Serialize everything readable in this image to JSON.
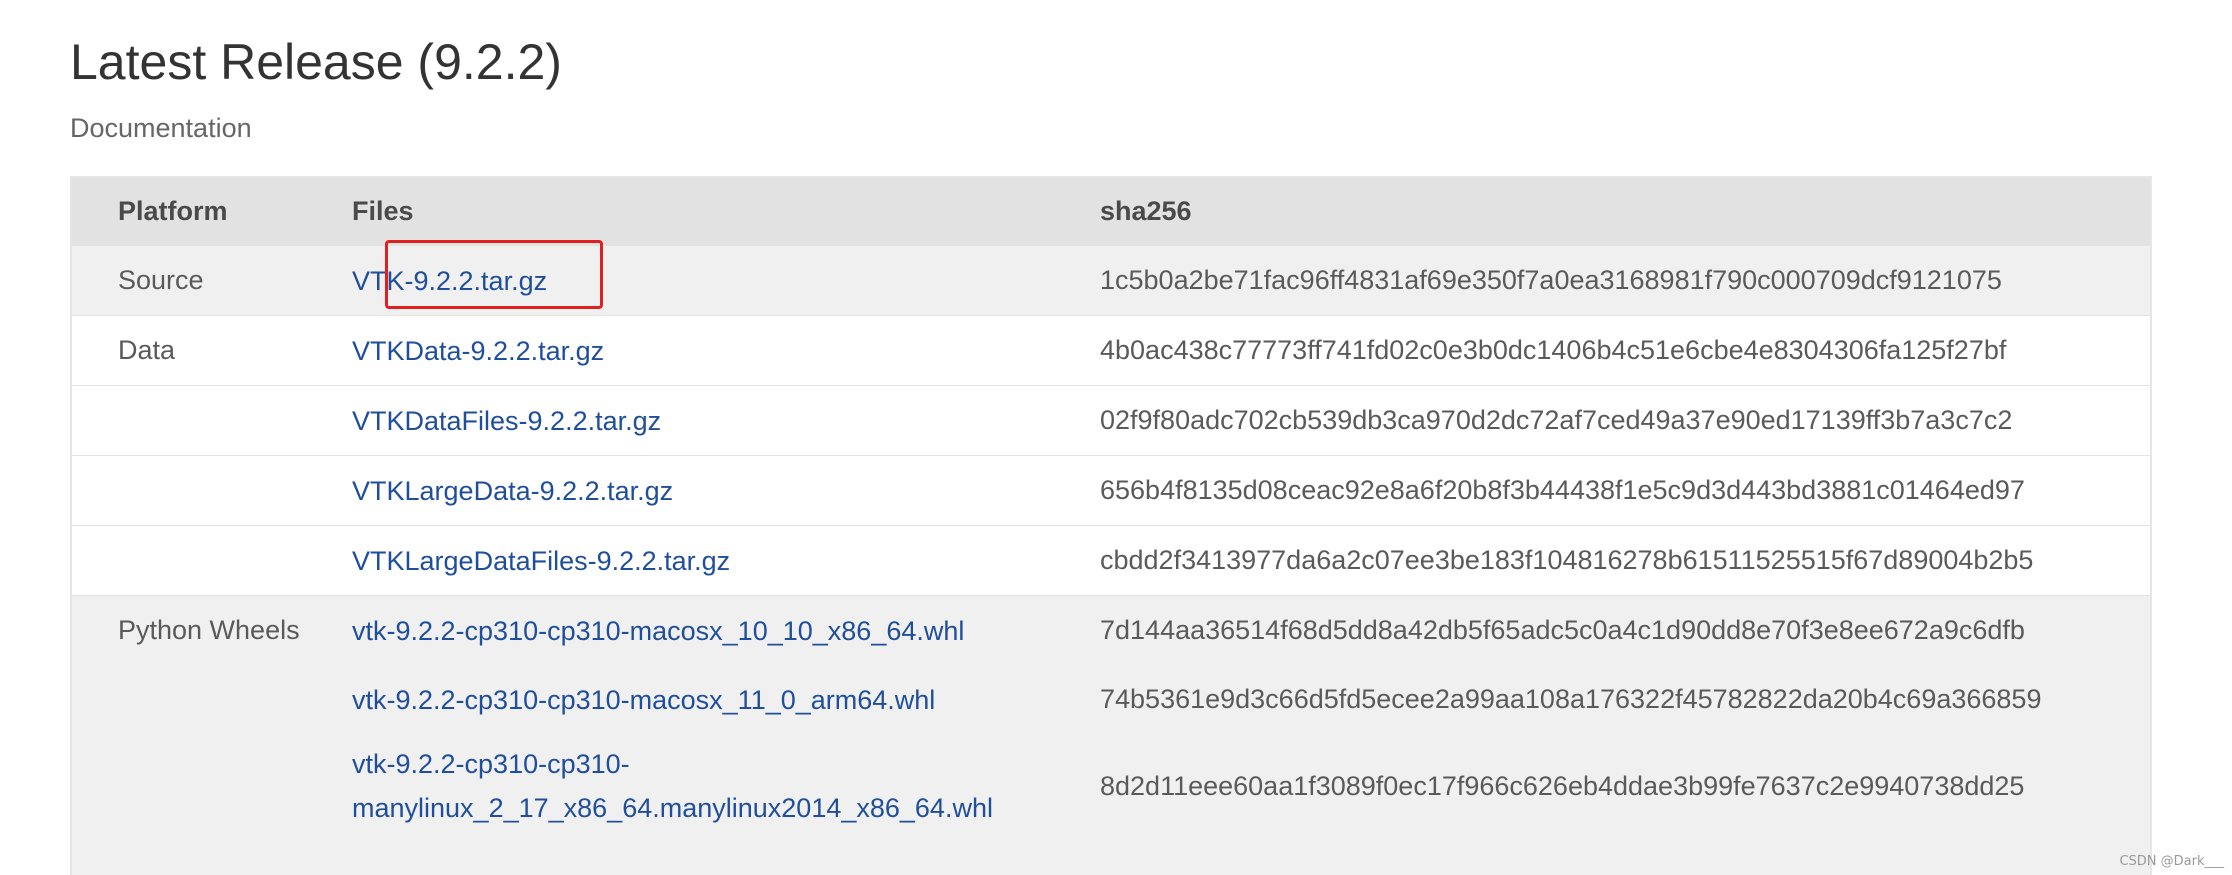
{
  "page": {
    "title": "Latest Release (9.2.2)",
    "documentation_link": "Documentation"
  },
  "table": {
    "headers": [
      "Platform",
      "Files",
      "sha256"
    ],
    "rows": [
      {
        "platform": "Source",
        "file": "VTK-9.2.2.tar.gz",
        "sha256": "1c5b0a2be71fac96ff4831af69e350f7a0ea3168981f790c000709dcf9121075"
      },
      {
        "platform": "Data",
        "file": "VTKData-9.2.2.tar.gz",
        "sha256": "4b0ac438c77773ff741fd02c0e3b0dc1406b4c51e6cbe4e8304306fa125f27bf"
      },
      {
        "platform": "",
        "file": "VTKDataFiles-9.2.2.tar.gz",
        "sha256": "02f9f80adc702cb539db3ca970d2dc72af7ced49a37e90ed17139ff3b7a3c7c2"
      },
      {
        "platform": "",
        "file": "VTKLargeData-9.2.2.tar.gz",
        "sha256": "656b4f8135d08ceac92e8a6f20b8f3b44438f1e5c9d3d443bd3881c01464ed97"
      },
      {
        "platform": "",
        "file": "VTKLargeDataFiles-9.2.2.tar.gz",
        "sha256": "cbdd2f3413977da6a2c07ee3be183f104816278b61511525515f67d89004b2b5"
      },
      {
        "platform": "Python Wheels",
        "file": "vtk-9.2.2-cp310-cp310-macosx_10_10_x86_64.whl",
        "sha256": "7d144aa36514f68d5dd8a42db5f65adc5c0a4c1d90dd8e70f3e8ee672a9c6dfb"
      },
      {
        "platform": "",
        "file": "vtk-9.2.2-cp310-cp310-macosx_11_0_arm64.whl",
        "sha256": "74b5361e9d3c66d5fd5ecee2a99aa108a176322f45782822da20b4c69a366859"
      },
      {
        "platform": "",
        "file_line1": "vtk-9.2.2-cp310-cp310-",
        "file_line2": "manylinux_2_17_x86_64.manylinux2014_x86_64.whl",
        "sha256": "8d2d11eee60aa1f3089f0ec17f966c626eb4ddae3b99fe7637c2e9940738dd25"
      }
    ]
  },
  "annotation": {
    "highlight_color": "#e02020"
  },
  "watermark": "CSDN @Dark___",
  "colors": {
    "link": "#1f4e9a",
    "header_bg": "#e2e2e2",
    "shaded_row_bg": "#f0f0f0"
  }
}
